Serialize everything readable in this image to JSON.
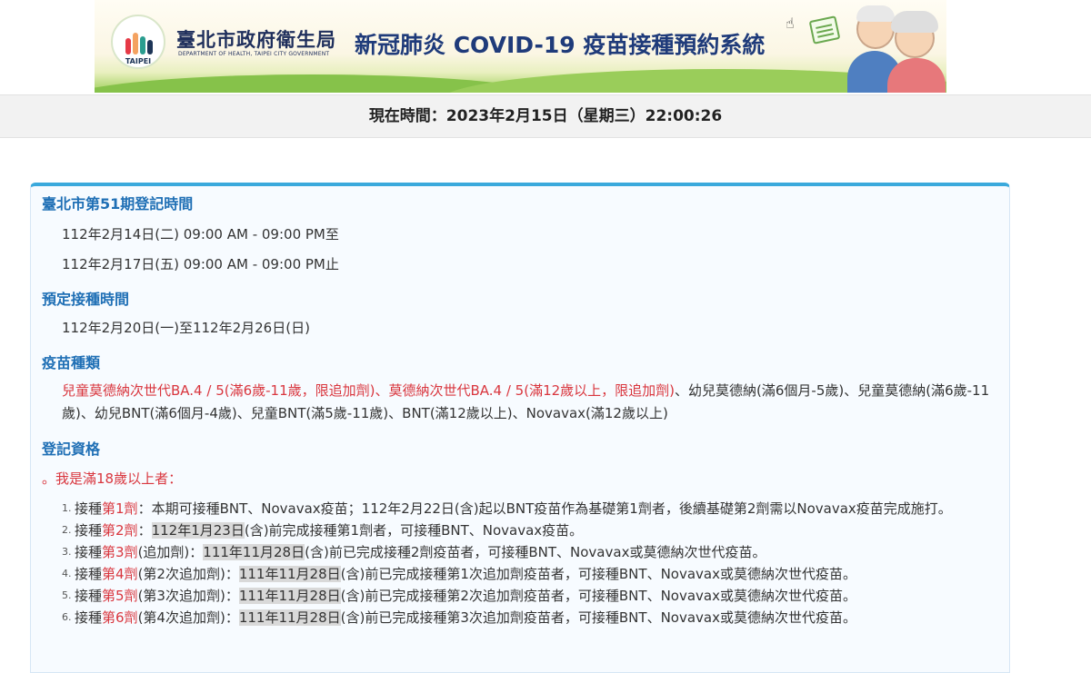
{
  "banner": {
    "logo_caption": "TAIPEI",
    "dept_cn": "臺北市政府衛生局",
    "dept_en": "DEPARTMENT OF HEALTH, TAIPEI CITY GOVERNMENT",
    "system_title": "新冠肺炎 COVID-19 疫苗接種預約系統"
  },
  "clock": {
    "text": "現在時間：2023年2月15日（星期三）22:00:26"
  },
  "registration": {
    "title": "臺北市第51期登記時間",
    "start": "112年2月14日(二) 09:00 AM - 09:00 PM至",
    "end": "112年2月17日(五) 09:00 AM - 09:00 PM止"
  },
  "vaccination": {
    "title": "預定接種時間",
    "period": "112年2月20日(一)至112年2月26日(日)"
  },
  "vaccine_types": {
    "title": "疫苗種類",
    "red_text": "兒童莫德納次世代BA.4 / 5(滿6歲-11歲，限追加劑)、莫德納次世代BA.4 / 5(滿12歲以上，限追加劑)",
    "rest_text": "、幼兒莫德納(滿6個月-5歲)、兒童莫德納(滿6歲-11歲)、幼兒BNT(滿6個月-4歲)、兒童BNT(滿5歲-11歲)、BNT(滿12歲以上)、Novavax(滿12歲以上)"
  },
  "eligibility": {
    "title": "登記資格",
    "subhead": "。我是滿18歲以上者：",
    "items": [
      {
        "num": "1.",
        "pre": "接種",
        "dose": "第1劑",
        "extra": "",
        "sep": "：",
        "date": "",
        "rest": "本期可接種BNT、Novavax疫苗；112年2月22日(含)起以BNT疫苗作為基礎第1劑者，後續基礎第2劑需以Novavax疫苗完成施打。"
      },
      {
        "num": "2.",
        "pre": "接種",
        "dose": "第2劑",
        "extra": "",
        "sep": "：",
        "date": "112年1月23日",
        "rest": "(含)前完成接種第1劑者，可接種BNT、Novavax疫苗。"
      },
      {
        "num": "3.",
        "pre": "接種",
        "dose": "第3劑",
        "extra": "(追加劑)",
        "sep": "：",
        "date": "111年11月28日",
        "rest": "(含)前已完成接種2劑疫苗者，可接種BNT、Novavax或莫德納次世代疫苗。"
      },
      {
        "num": "4.",
        "pre": "接種",
        "dose": "第4劑",
        "extra": "(第2次追加劑)",
        "sep": "：",
        "date": "111年11月28日",
        "rest": "(含)前已完成接種第1次追加劑疫苗者，可接種BNT、Novavax或莫德納次世代疫苗。"
      },
      {
        "num": "5.",
        "pre": "接種",
        "dose": "第5劑",
        "extra": "(第3次追加劑)",
        "sep": "：",
        "date": "111年11月28日",
        "rest": "(含)前已完成接種第2次追加劑疫苗者，可接種BNT、Novavax或莫德納次世代疫苗。"
      },
      {
        "num": "6.",
        "pre": "接種",
        "dose": "第6劑",
        "extra": "(第4次追加劑)",
        "sep": "：",
        "date": "111年11月28日",
        "rest": "(含)前已完成接種第3次追加劑疫苗者，可接種BNT、Novavax或莫德納次世代疫苗。"
      }
    ]
  },
  "colors": {
    "accent": "#3aa9dc",
    "title_blue": "#1f6fb5",
    "red": "#d9363e",
    "highlight": "#d9d9d9"
  }
}
